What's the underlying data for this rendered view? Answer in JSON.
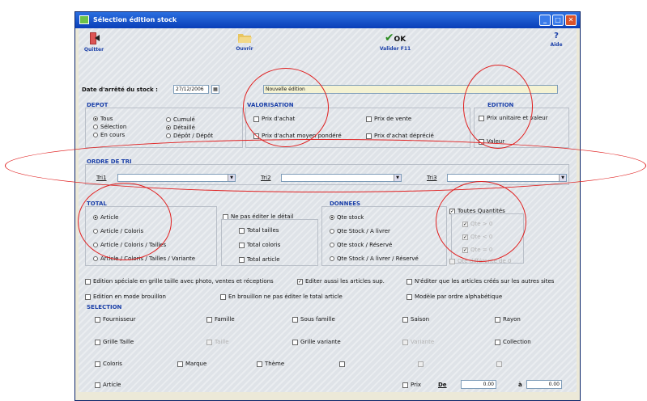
{
  "window": {
    "title": "Sélection édition stock"
  },
  "toolbar": {
    "quit": "Quitter",
    "open": "Ouvrir",
    "validate": "Valider F11",
    "validate_icon_text": "OK",
    "help": "Aide"
  },
  "header": {
    "date_label": "Date d'arrêté du stock :",
    "date_value": "27/12/2006",
    "edition_name": "Nouvelle édition"
  },
  "depot": {
    "title": "DEPOT",
    "col1": [
      {
        "label": "Tous",
        "selected": true
      },
      {
        "label": "Sélection",
        "selected": false
      },
      {
        "label": "En cours",
        "selected": false
      }
    ],
    "col2": [
      {
        "label": "Cumulé",
        "selected": false
      },
      {
        "label": "Détaillé",
        "selected": true
      },
      {
        "label": "Dépôt / Dépôt",
        "selected": false
      }
    ]
  },
  "valorisation": {
    "title": "VALORISATION",
    "items": [
      {
        "label": "Prix d'achat"
      },
      {
        "label": "Prix de vente"
      },
      {
        "label": "Prix d'achat moyen pondéré"
      },
      {
        "label": "Prix d'achat déprécié"
      }
    ]
  },
  "edition": {
    "title": "EDITION",
    "items": [
      {
        "label": "Prix unitaire et valeur"
      },
      {
        "label": "Valeur"
      }
    ]
  },
  "ordre": {
    "title": "ORDRE DE TRI",
    "tri1": "Tri1",
    "tri2": "Tri2",
    "tri3": "Tri3"
  },
  "total": {
    "title": "TOTAL",
    "items": [
      {
        "label": "Article",
        "selected": true
      },
      {
        "label": "Article / Coloris",
        "selected": false
      },
      {
        "label": "Article / Coloris / Tailles",
        "selected": false
      },
      {
        "label": "Article / Coloris / Tailles / Variante",
        "selected": false
      }
    ],
    "no_detail": "Ne pas éditer le détail",
    "checks": [
      {
        "label": "Total tailles"
      },
      {
        "label": "Total coloris"
      },
      {
        "label": "Total article"
      }
    ]
  },
  "donnees": {
    "title": "DONNEES",
    "items": [
      {
        "label": "Qte stock",
        "selected": true
      },
      {
        "label": "Qte Stock / A livrer",
        "selected": false
      },
      {
        "label": "Qte stock / Réservé",
        "selected": false
      },
      {
        "label": "Qte Stock / A livrer / Réservé",
        "selected": false
      }
    ]
  },
  "quantites": {
    "toutes": "Toutes Quantités",
    "sub": [
      "Qte > 0",
      "Qte < 0",
      "Qte = 0",
      "Qte différente de 0"
    ]
  },
  "options": {
    "grille_photo": "Edition spéciale en grille taille avec photo, ventes et réceptions",
    "articles_sup": "Editer aussi les articles sup.",
    "non_crees": "N'éditer que les articles créés sur les autres sites",
    "brouillon": "Edition en mode brouillon",
    "brouillon_total": "En brouillon ne pas éditer le total article",
    "alpha": "Modèle par ordre alphabétique"
  },
  "selection": {
    "title": "SELECTION",
    "fournisseur": "Fournisseur",
    "famille": "Famille",
    "sous_famille": "Sous famille",
    "saison": "Saison",
    "rayon": "Rayon",
    "grille_taille": "Grille Taille",
    "taille": "Taille",
    "grille_variante": "Grille variante",
    "variante": "Variante",
    "collection": "Collection",
    "coloris": "Coloris",
    "marque": "Marque",
    "theme": "Thème",
    "article": "Article",
    "prix": "Prix",
    "de": "De",
    "a": "à",
    "prix_de": "0.00",
    "prix_a": "0.00"
  }
}
